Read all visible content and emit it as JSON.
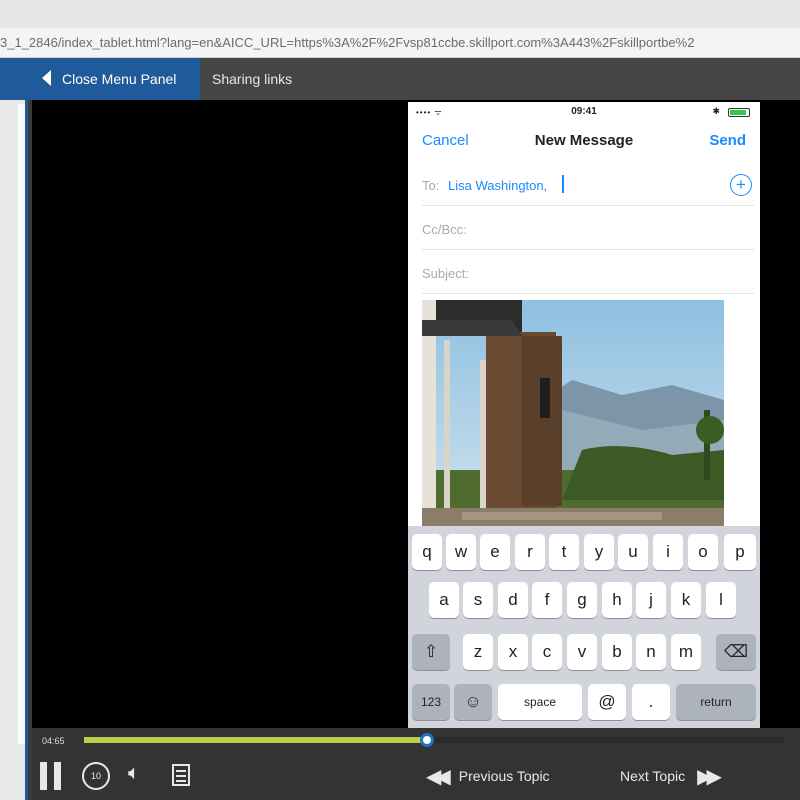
{
  "browser": {
    "url": "3_1_2846/index_tablet.html?lang=en&AICC_URL=https%3A%2F%2Fvsp81ccbe.skillport.com%3A443%2Fskillportbe%2"
  },
  "header": {
    "close_menu_label": "Close Menu Panel",
    "sharing_label": "Sharing links"
  },
  "phone": {
    "status_time": "09:41",
    "nav": {
      "cancel": "Cancel",
      "title": "New Message",
      "send": "Send"
    },
    "to_label": "To:",
    "to_value": "Lisa Washington,",
    "cc_label": "Cc/Bcc:",
    "subject_label": "Subject:"
  },
  "keyboard": {
    "row1": [
      "q",
      "w",
      "e",
      "r",
      "t",
      "y",
      "u",
      "i",
      "o",
      "p"
    ],
    "row2": [
      "a",
      "s",
      "d",
      "f",
      "g",
      "h",
      "j",
      "k",
      "l"
    ],
    "row3": [
      "z",
      "x",
      "c",
      "v",
      "b",
      "n",
      "m"
    ],
    "num_key": "123",
    "space_key": "space",
    "at_key": "@",
    "dot_key": ".",
    "return_key": "return"
  },
  "player": {
    "time": "04:65",
    "progress": 0.49,
    "prev_label": "Previous Topic",
    "next_label": "Next Topic",
    "accent_color": "#b7d048",
    "brand_color": "#1f5a9a"
  }
}
